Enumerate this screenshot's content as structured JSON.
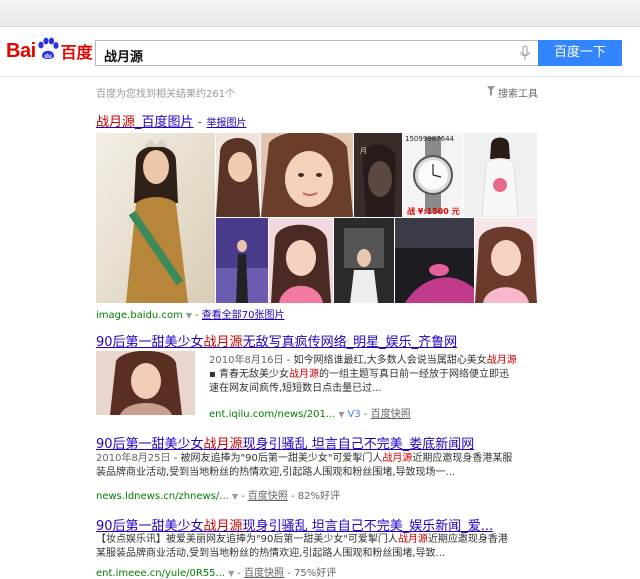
{
  "header": {
    "logo_latin_1": "Bai",
    "logo_latin_2": "du",
    "logo_cn": "百度",
    "query": "战月源",
    "search_button": "百度一下"
  },
  "meta": {
    "results_info": "百度为您找到相关结果约261个",
    "search_tools": "搜索工具"
  },
  "image_result": {
    "title_query": "战月源",
    "title_suffix": "_百度图片",
    "separator": " - ",
    "report": "举报图片",
    "source": "image.baidu.com",
    "view_all": "查看全部70张图片",
    "watch_overlay": "15099987644",
    "price_overlay": "战 ¥:1500 元"
  },
  "results": [
    {
      "title_pre": "90后第一甜美少女",
      "title_em": "战月源",
      "title_post": "无敌写真疯传网络_明星_娱乐_齐鲁网",
      "date": "2010年8月16日",
      "snippet_1_pre": " - 如今网络谁最红,大多数人会说当属甜心美女",
      "snippet_1_em": "战月源",
      "snippet_2_pre": "▪ 青春无敌美少女",
      "snippet_2_em": "战月源",
      "snippet_2_post": "的一组主题写真日前一经放于网络便立即迅",
      "snippet_3": "速在网友间疯传,短短数日点击量已过...",
      "url": "ent.iqilu.com/news/201...",
      "v_badge": "V3",
      "cache": "百度快照"
    },
    {
      "title_pre": "90后第一甜美少女",
      "title_em": "战月源",
      "title_post": "现身引骚乱 坦言自己不完美_娄底新闻网",
      "date": "2010年8月25日",
      "snippet_1_pre": " - 被网友追捧为\"90后第一甜美少女\"可爱掣门人",
      "snippet_1_em": "战月源",
      "snippet_1_post": "近期应邀现身香港某服",
      "snippet_2": "装品牌商业活动,受到当地粉丝的热情欢迎,引起路人围观和粉丝围堵,导致现场一...",
      "url": "news.ldnews.cn/zhnews/...",
      "cache": "百度快照",
      "rating": "82%好评"
    },
    {
      "title_pre": "90后第一甜美少女",
      "title_em": "战月源",
      "title_post": "现身引骚乱 坦言自己不完美_娱乐新闻_爱...",
      "snippet_1_pre": "【妆点娱乐讯】被爱美丽网友追捧为\"90后第一甜美少女\"可爱掣门人",
      "snippet_1_em": "战月源",
      "snippet_1_post": "近期应邀现身香港",
      "snippet_2": "某服装品牌商业活动,受到当地粉丝的热情欢迎,引起路人围观和粉丝围堵,导致...",
      "url": "ent.imeee.cn/yule/0R55...",
      "cache": "百度快照",
      "rating": "75%好评"
    }
  ],
  "colors": {
    "brand_red": "#e10601",
    "button_blue": "#3385ff",
    "link": "#2200c1",
    "highlight": "#cc0000",
    "url_green": "#008000"
  }
}
